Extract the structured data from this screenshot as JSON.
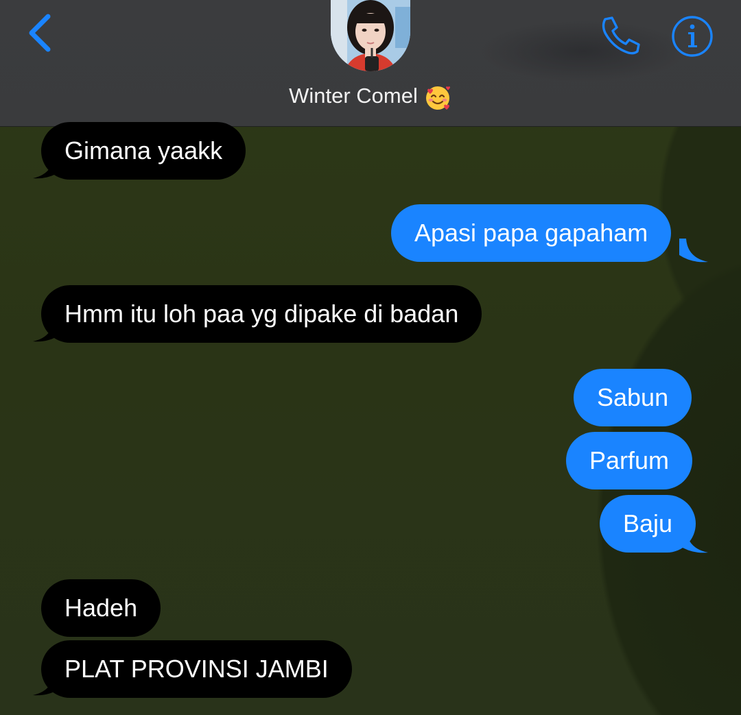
{
  "header": {
    "contact_name": "Winter Comel",
    "back_icon": "chevron-left-icon",
    "call_icon": "phone-icon",
    "info_icon": "info-icon",
    "accent": "#1a84ff"
  },
  "messages": [
    {
      "direction": "received",
      "text": "Gimana yaakk"
    },
    {
      "direction": "sent",
      "text": "Apasi papa gapaham"
    },
    {
      "direction": "received",
      "text": "Hmm itu loh paa yg dipake di badan"
    },
    {
      "direction": "sent",
      "text": "Sabun"
    },
    {
      "direction": "sent",
      "text": "Parfum"
    },
    {
      "direction": "sent",
      "text": "Baju"
    },
    {
      "direction": "received",
      "text": "Hadeh"
    },
    {
      "direction": "received",
      "text": "PLAT PROVINSI JAMBI"
    }
  ],
  "colors": {
    "sent_bubble": "#1a84ff",
    "received_bubble": "#000000",
    "header_bg": "#3b3c3e",
    "wallpaper": "#2b3417"
  }
}
